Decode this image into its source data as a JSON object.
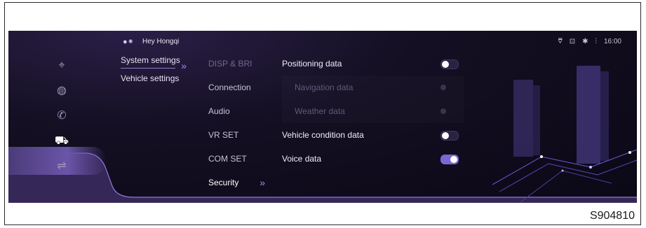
{
  "status": {
    "assistant_name": "Hey Hongqi",
    "time": "16:00"
  },
  "rail": {
    "items": [
      {
        "icon": "map-pin-icon"
      },
      {
        "icon": "speedometer-icon"
      },
      {
        "icon": "phone-icon"
      },
      {
        "icon": "car-icon",
        "active": true
      },
      {
        "icon": "charging-icon"
      }
    ]
  },
  "settings_menu": [
    {
      "label": "System settings",
      "active": true
    },
    {
      "label": "Vehicle settings",
      "active": false
    }
  ],
  "submenu": [
    {
      "label": "DISP & BRI"
    },
    {
      "label": "Connection"
    },
    {
      "label": "Audio"
    },
    {
      "label": "VR SET"
    },
    {
      "label": "COM SET"
    },
    {
      "label": "Security",
      "active": true
    }
  ],
  "content": {
    "rows": [
      {
        "label": "Positioning data",
        "type": "toggle",
        "on": false
      },
      {
        "label": "Navigation data",
        "type": "disabled"
      },
      {
        "label": "Weather data",
        "type": "disabled"
      },
      {
        "label": "Vehicle condition data",
        "type": "toggle",
        "on": false
      },
      {
        "label": "Voice data",
        "type": "toggle",
        "on": true
      }
    ]
  },
  "figure_label": "S904810"
}
